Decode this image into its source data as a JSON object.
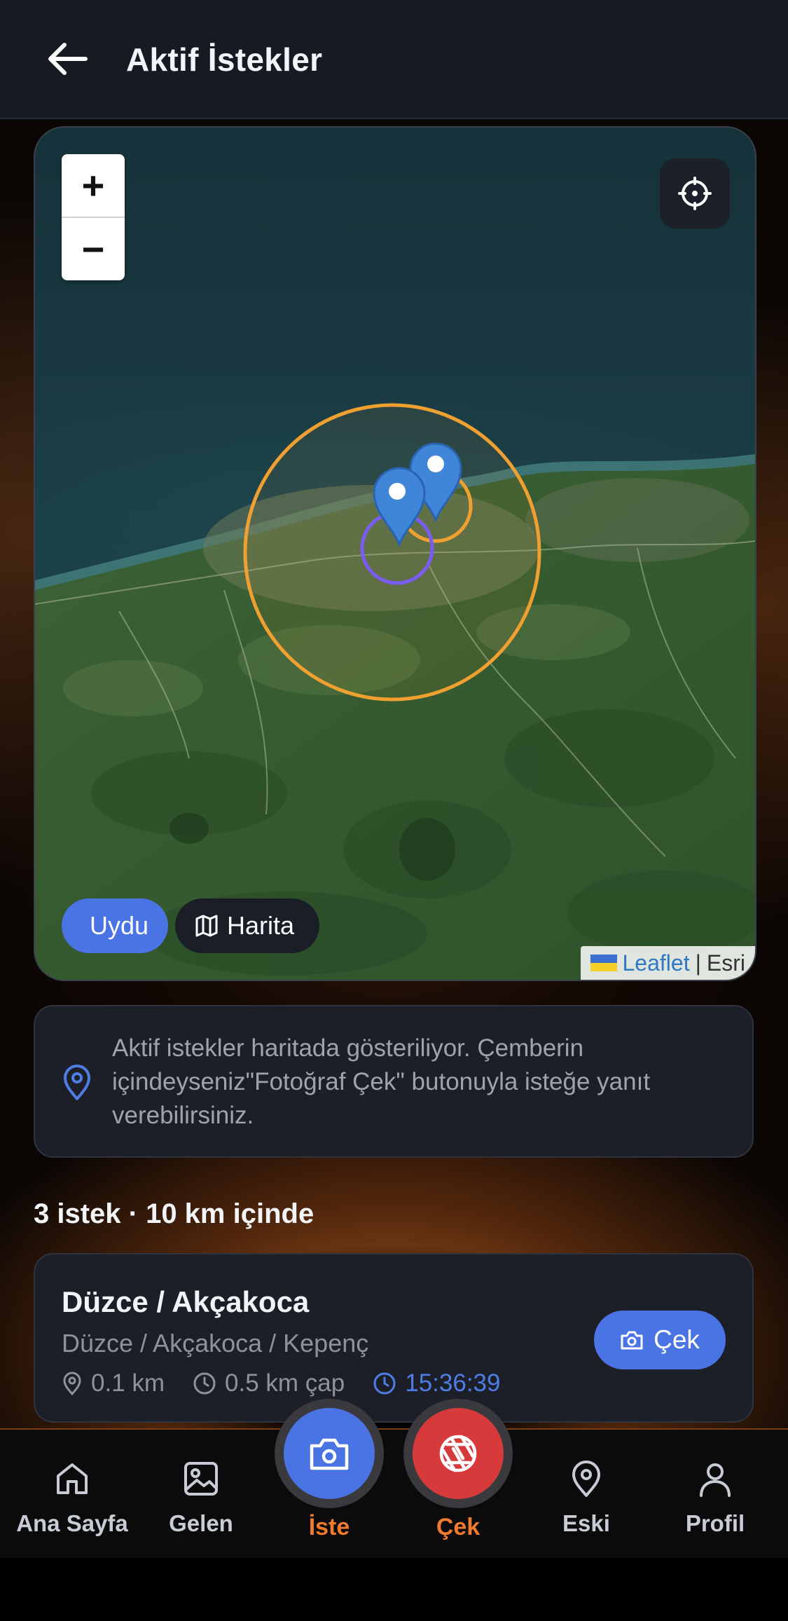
{
  "header": {
    "title": "Aktif İstekler",
    "back_icon": "arrow-left-icon"
  },
  "map": {
    "zoom_in_label": "+",
    "zoom_out_label": "−",
    "locate_icon": "crosshair-icon",
    "layers": [
      {
        "label": "Uydu",
        "icon": "satellite-icon",
        "active": true
      },
      {
        "label": "Harita",
        "icon": "map-icon",
        "active": false
      }
    ],
    "attribution": {
      "leaflet": "Leaflet",
      "separator": "|",
      "provider": "Esri"
    },
    "colors": {
      "radius_large": "#f0a030",
      "radius_small_orange": "#f0a030",
      "radius_small_purple": "#7b5cf0",
      "marker": "#3f86d8"
    }
  },
  "info": {
    "icon": "map-pin-icon",
    "text": "Aktif istekler haritada gösteriliyor. Çemberin içindeyseniz\"Fotoğraf Çek\" butonuyla isteğe yanıt verebilirsiniz."
  },
  "summary": {
    "text": "3 istek · 10 km içinde"
  },
  "requests": [
    {
      "title": "Düzce / Akçakoca",
      "subtitle": "Düzce / Akçakoca / Kepenç",
      "distance": "0.1 km",
      "radius": "0.5 km çap",
      "time": "15:36:39",
      "action_label": "Çek"
    }
  ],
  "nav": {
    "items": [
      {
        "label": "Ana Sayfa",
        "icon": "home-icon"
      },
      {
        "label": "Gelen",
        "icon": "image-icon"
      },
      {
        "label": "İste",
        "icon": "camera-icon",
        "fab": true,
        "color": "#4a74e4"
      },
      {
        "label": "Çek",
        "icon": "aperture-icon",
        "fab": true,
        "color": "#d63a3a"
      },
      {
        "label": "Eski",
        "icon": "map-pin-icon"
      },
      {
        "label": "Profil",
        "icon": "user-icon"
      }
    ],
    "accent": "#f07a2e"
  }
}
